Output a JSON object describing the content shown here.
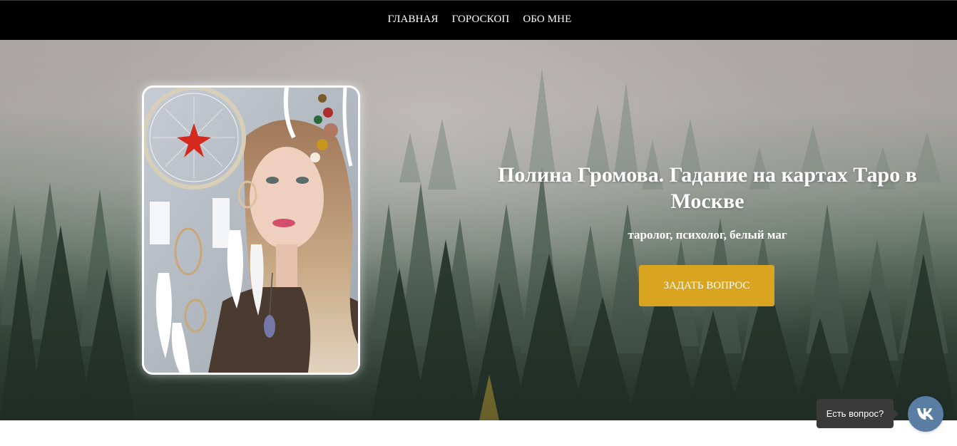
{
  "nav": {
    "items": [
      {
        "label": "ГЛАВНАЯ"
      },
      {
        "label": "ГОРОСКОП"
      },
      {
        "label": "ОБО МНЕ"
      }
    ]
  },
  "hero": {
    "title": "Полина Громова. Гадание на картах Таро в Москве",
    "subtitle": "таролог, психолог, белый маг",
    "cta_label": "ЗАДАТЬ ВОПРОС",
    "photo_alt": "Полина Громова"
  },
  "chat_widget": {
    "tooltip": "Есть вопрос?",
    "icon": "vk-icon"
  },
  "colors": {
    "nav_bg": "#000000",
    "cta_bg": "#d9a420",
    "vk_bg": "#5a7da4",
    "tooltip_bg": "#3a3a3a"
  }
}
